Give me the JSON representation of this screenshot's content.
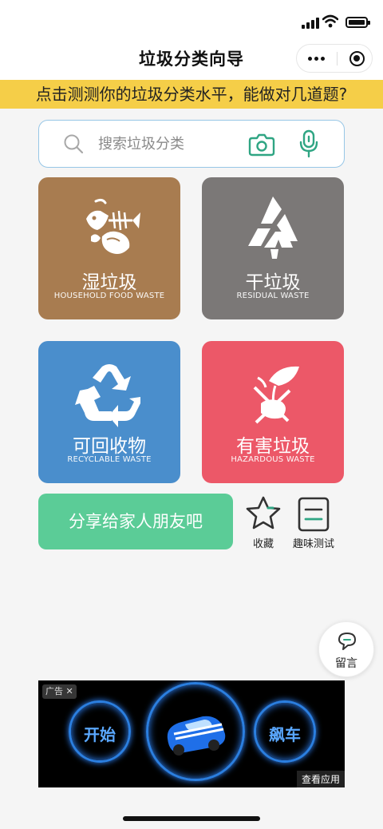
{
  "nav": {
    "title": "垃圾分类向导"
  },
  "banner": {
    "text": "点击测测你的垃圾分类水平，能做对几道题?"
  },
  "search": {
    "placeholder": "搜索垃圾分类"
  },
  "categories": [
    {
      "name": "湿垃圾",
      "en": "HOUSEHOLD FOOD WASTE",
      "icon": "fish-bone-icon",
      "color": "#a87c50"
    },
    {
      "name": "干垃圾",
      "en": "RESIDUAL WASTE",
      "icon": "residual-waste-icon",
      "color": "#7b7877"
    },
    {
      "name": "可回收物",
      "en": "RECYCLABLE WASTE",
      "icon": "recycle-icon",
      "color": "#4a8ecc"
    },
    {
      "name": "有害垃圾",
      "en": "HAZARDOUS WASTE",
      "icon": "hazardous-icon",
      "color": "#ec5868"
    }
  ],
  "share": {
    "label": "分享给家人朋友吧"
  },
  "tools": {
    "favorite": "收藏",
    "quiz": "趣味测试"
  },
  "comment": {
    "label": "留言"
  },
  "ad": {
    "tag": "广告",
    "left_text": "开始",
    "right_text": "飙车",
    "view_app": "查看应用"
  },
  "colors": {
    "accent_yellow": "#f5ce48",
    "share_green": "#5bcc97",
    "search_border": "#97c6e6"
  }
}
